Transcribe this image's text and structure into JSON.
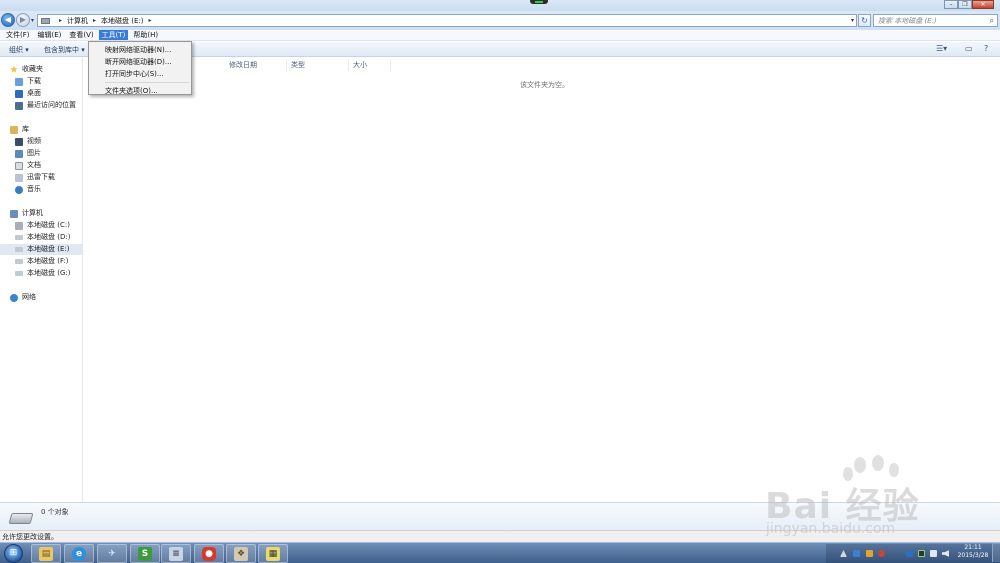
{
  "address": {
    "crumbs": [
      "计算机",
      "本地磁盘 (E:)"
    ],
    "search_placeholder": "搜索 本地磁盘 (E:)"
  },
  "menubar": {
    "items": [
      "文件(F)",
      "编辑(E)",
      "查看(V)",
      "工具(T)",
      "帮助(H)"
    ],
    "active": "工具(T)"
  },
  "commandbar": {
    "organize": "组织 ▾",
    "include_in_library": "包含到库中 ▾"
  },
  "tools_menu": {
    "items": [
      "映射网络驱动器(N)...",
      "断开网络驱动器(D)...",
      "打开同步中心(S)..."
    ],
    "folder_options": "文件夹选项(O)..."
  },
  "navpane": {
    "favorites": {
      "header": "收藏夹",
      "items": [
        "下载",
        "桌面",
        "最近访问的位置"
      ]
    },
    "libraries": {
      "header": "库",
      "items": [
        "视频",
        "图片",
        "文档",
        "迅雷下载",
        "音乐"
      ]
    },
    "computer": {
      "header": "计算机",
      "items": [
        "本地磁盘 (C:)",
        "本地磁盘 (D:)",
        "本地磁盘 (E:)",
        "本地磁盘 (F:)",
        "本地磁盘 (G:)"
      ],
      "selected": "本地磁盘 (E:)"
    },
    "network": {
      "header": "网络"
    }
  },
  "columns": [
    "修改日期",
    "类型",
    "大小"
  ],
  "empty_message": "该文件夹为空。",
  "details": {
    "count": "0 个对象"
  },
  "statusbar": {
    "text": "允许您更改设置。"
  },
  "taskbar": {
    "apps": [
      "explorer-icon",
      "ie-icon",
      "plane-icon",
      "wps-s-icon",
      "notepad-icon",
      "red-app-icon",
      "photo-app-icon",
      "calendar-icon"
    ],
    "clock_time": "21:11",
    "clock_date": "2015/3/28"
  },
  "watermark": {
    "text": "Bai 经验",
    "sub": "jingyan.baidu.com"
  },
  "colors": {
    "menu_highlight": "#3a7cd9",
    "taskbar": "#4f6f9a",
    "selection": "#dfe8f3"
  }
}
